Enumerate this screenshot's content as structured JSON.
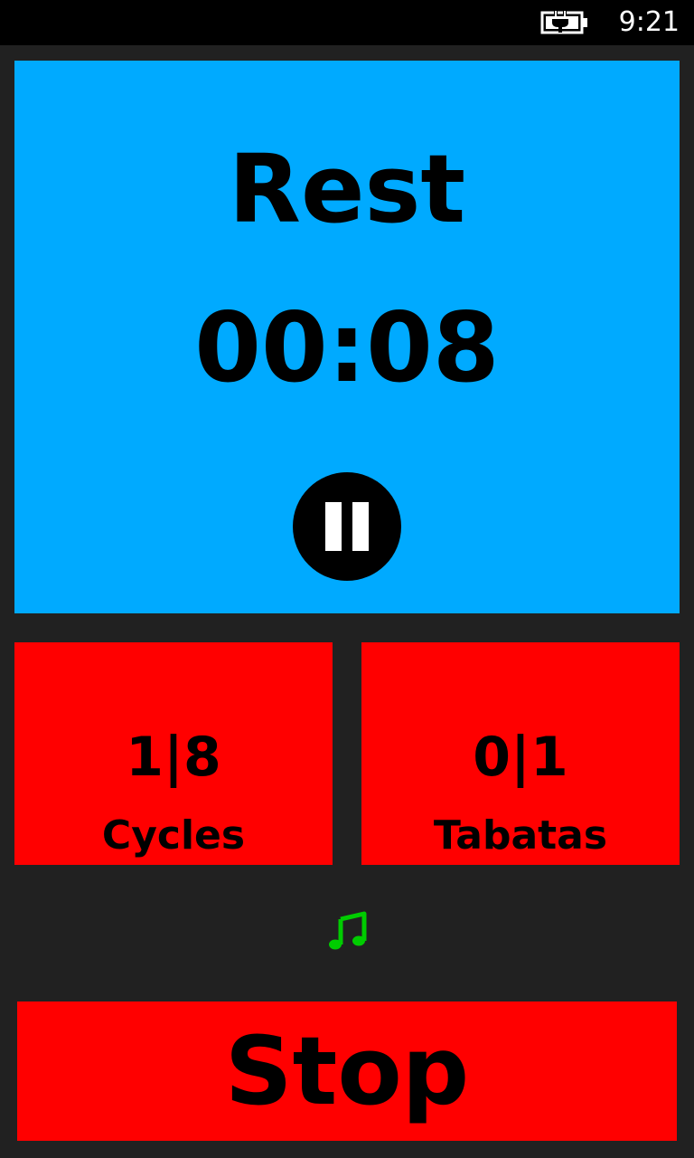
{
  "status_bar": {
    "time": "9:21",
    "battery_icon": "battery-charging-icon"
  },
  "timer": {
    "phase": "Rest",
    "time": "00:08",
    "pause_icon": "pause-icon"
  },
  "counters": {
    "cycles": {
      "value": "1|8",
      "label": "Cycles"
    },
    "tabatas": {
      "value": "0|1",
      "label": "Tabatas"
    }
  },
  "music": {
    "icon": "music-note-icon",
    "color": "#00cc00"
  },
  "stop_button": {
    "label": "Stop"
  },
  "colors": {
    "background": "#212121",
    "timer_panel": "#00aaff",
    "tile": "#ff0000",
    "text": "#000000"
  }
}
